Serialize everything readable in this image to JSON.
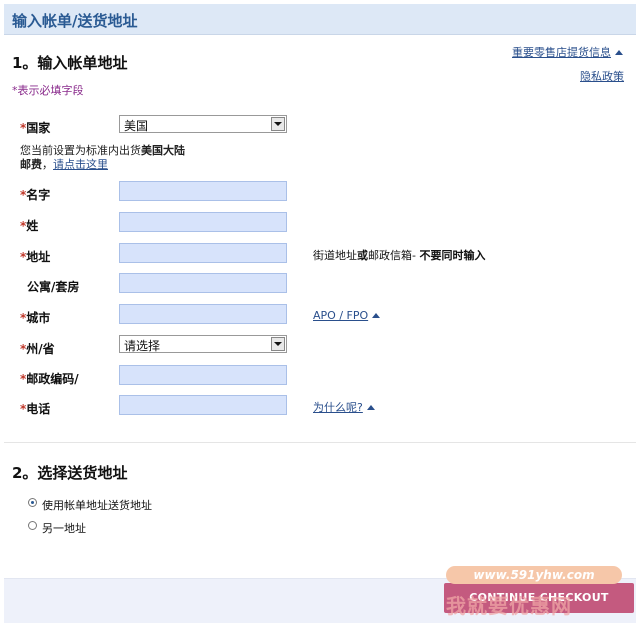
{
  "header": {
    "title": "输入帐单/送货地址"
  },
  "billing": {
    "section_title": "1。输入帐单地址",
    "required_note": "*表示必填字段",
    "links": {
      "important_info": "重要零售店提货信息",
      "privacy": "隐私政策"
    },
    "country": {
      "label": "国家",
      "value": "美国"
    },
    "shipping_notice": {
      "line1_prefix": "您当前设置为标准内出货",
      "line1_bold": "美国大陆",
      "line2_bold": "邮费",
      "line2_sep": "，",
      "link": "请点击这里"
    },
    "fields": {
      "first_name": {
        "label": "名字",
        "value": ""
      },
      "last_name": {
        "label": "姓",
        "value": ""
      },
      "address": {
        "label": "地址",
        "value": ""
      },
      "address_note_part1": "街道地址",
      "address_note_part2": "或",
      "address_note_part3": "邮政信箱",
      "address_note_part4": "- ",
      "address_note_part5": "不要同时输入",
      "apartment": {
        "label": "公寓/套房",
        "value": ""
      },
      "city": {
        "label": "城市",
        "value": ""
      },
      "apo_link": "APO / FPO",
      "state": {
        "label": "州/省",
        "value": "请选择"
      },
      "zip": {
        "label": "邮政编码/",
        "value": ""
      },
      "phone": {
        "label": "电话",
        "value": ""
      },
      "why_link": "为什么呢?"
    }
  },
  "shipping": {
    "section_title": "2。选择送货地址",
    "options": [
      {
        "label": "使用帐单地址送货地址",
        "checked": true
      },
      {
        "label": "另一地址",
        "checked": false
      }
    ]
  },
  "footer": {
    "checkout_label": "CONTINUE CHECKOUT"
  },
  "watermark": {
    "url": "www.591yhw.com",
    "text": "我就要优惠网"
  }
}
